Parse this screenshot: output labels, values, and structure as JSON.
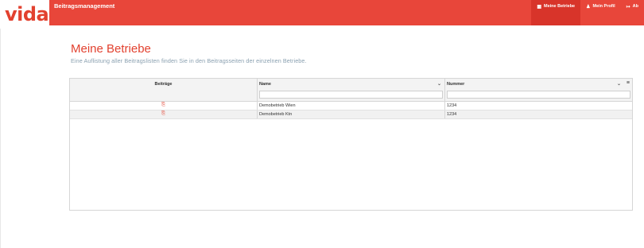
{
  "logo": {
    "text": "vida"
  },
  "navbar": {
    "brand": "Beitragsmanagement",
    "items": [
      {
        "label": "Meine Betriebe",
        "icon": "building-icon",
        "glyph": "▦",
        "active": true
      },
      {
        "label": "Mein Profil",
        "icon": "user-icon",
        "glyph": "♟",
        "active": false
      },
      {
        "label": "Ab",
        "icon": "logout-icon",
        "glyph": "↦",
        "active": false
      }
    ]
  },
  "page": {
    "title": "Meine Betriebe",
    "subtitle": "Eine Auflistung aller Beitragslisten finden Sie in den Beitragsseiten der einzelnen Betriebe."
  },
  "grid": {
    "columns": [
      {
        "label": "Beiträge"
      },
      {
        "label": "Name"
      },
      {
        "label": "Nummer"
      }
    ],
    "rows": [
      {
        "name": "Demobetrieb Wien",
        "nummer": "1234"
      },
      {
        "name": "Demobetrieb Ktn",
        "nummer": "1234"
      }
    ]
  },
  "colors": {
    "accent": "#e8463a",
    "title": "#e2412f",
    "subtitle": "#8aa0b0"
  }
}
